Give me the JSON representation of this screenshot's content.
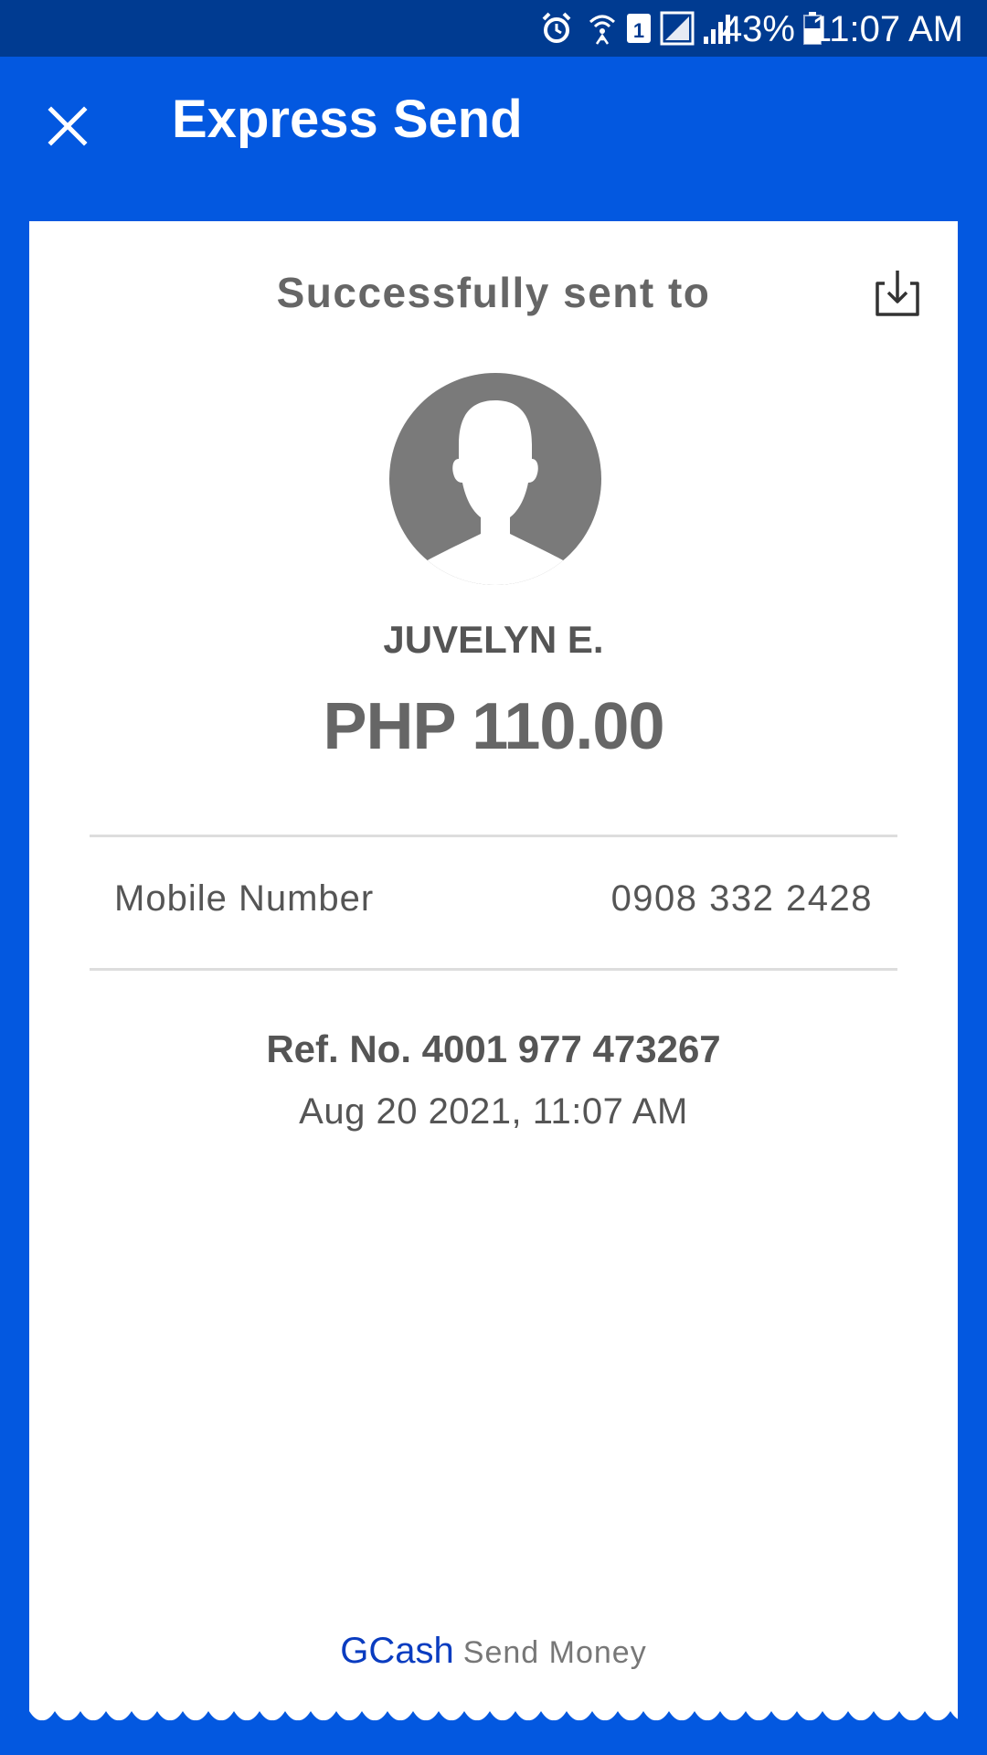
{
  "status_bar": {
    "battery": "43%",
    "time": "11:07 AM",
    "icons": [
      "alarm-icon",
      "wifi-calling-icon",
      "sim-1-icon",
      "signal-sim1-icon",
      "signal-sim2-icon",
      "battery-icon"
    ]
  },
  "app_bar": {
    "title": "Express Send",
    "close_icon": "close-icon"
  },
  "receipt": {
    "heading": "Successfully sent to",
    "download_icon": "download-icon",
    "avatar_icon": "person-avatar-icon",
    "recipient_name": "JUVELYN E.",
    "amount": "PHP 110.00",
    "details": {
      "label": "Mobile Number",
      "value": "0908 332 2428"
    },
    "reference": "Ref. No. 4001 977 473267",
    "datetime": "Aug 20 2021, 11:07 AM",
    "footer": {
      "brand": "GCash",
      "product": "Send Money"
    }
  },
  "colors": {
    "primary_blue": "#0358e0",
    "status_bar": "#003b91",
    "brand_text": "#0a3cc0"
  }
}
